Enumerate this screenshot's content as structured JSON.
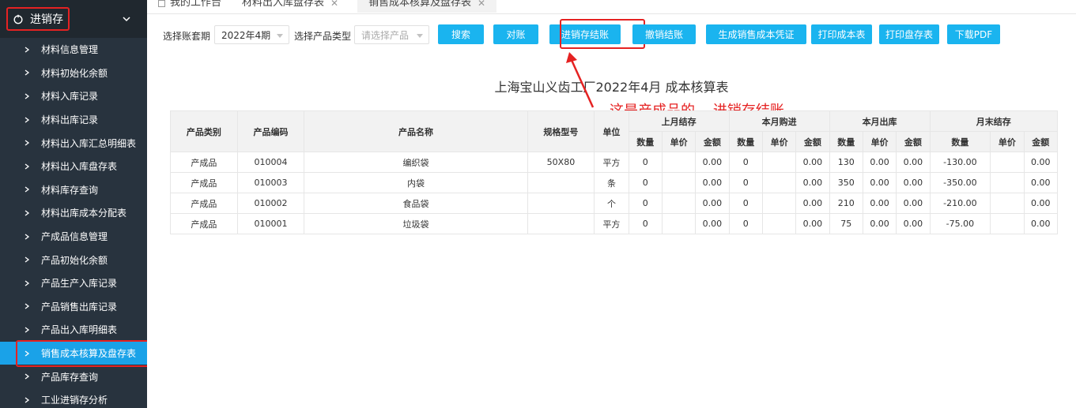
{
  "sidebar": {
    "title": "进销存",
    "items": [
      {
        "label": "材料信息管理"
      },
      {
        "label": "材料初始化余额"
      },
      {
        "label": "材料入库记录"
      },
      {
        "label": "材料出库记录"
      },
      {
        "label": "材料出入库汇总明细表"
      },
      {
        "label": "材料出入库盘存表"
      },
      {
        "label": "材料库存查询"
      },
      {
        "label": "材料出库成本分配表"
      },
      {
        "label": "产成品信息管理"
      },
      {
        "label": "产品初始化余额"
      },
      {
        "label": "产品生产入库记录"
      },
      {
        "label": "产品销售出库记录"
      },
      {
        "label": "产品出入库明细表"
      },
      {
        "label": "销售成本核算及盘存表",
        "active": true
      },
      {
        "label": "产品库存查询"
      },
      {
        "label": "工业进销存分析"
      }
    ]
  },
  "tabs": [
    {
      "label": "我的工作台"
    },
    {
      "label": "材料出入库盘存表"
    },
    {
      "label": "销售成本核算及盘存表",
      "active": true
    }
  ],
  "toolbar": {
    "period_label": "选择账套期",
    "period_value": "2022年4期",
    "type_label": "选择产品类型",
    "type_placeholder": "请选择产品",
    "buttons": {
      "search": "搜索",
      "reconcile": "对账",
      "close_account": "进销存结账",
      "undo_close": "撤销结账",
      "gen_voucher": "生成销售成本凭证",
      "print_cost": "打印成本表",
      "print_inventory": "打印盘存表",
      "download_pdf": "下载PDF"
    }
  },
  "report": {
    "title": "上海宝山义齿工厂2022年4月 成本核算表",
    "annotation": "这是产成品的    进销存结账"
  },
  "table": {
    "headers": {
      "category": "产品类别",
      "code": "产品编码",
      "name": "产品名称",
      "spec": "规格型号",
      "unit": "单位",
      "groups": [
        "上月结存",
        "本月购进",
        "本月出库",
        "月末结存"
      ],
      "sub": [
        "数量",
        "单价",
        "金额"
      ]
    },
    "rows": [
      [
        "产成品",
        "010004",
        "编织袋",
        "50X80",
        "平方",
        "0",
        "",
        "0.00",
        "0",
        "",
        "0.00",
        "130",
        "0.00",
        "0.00",
        "-130.00",
        "",
        "0.00"
      ],
      [
        "产成品",
        "010003",
        "内袋",
        "",
        "条",
        "0",
        "",
        "0.00",
        "0",
        "",
        "0.00",
        "350",
        "0.00",
        "0.00",
        "-350.00",
        "",
        "0.00"
      ],
      [
        "产成品",
        "010002",
        "食品袋",
        "",
        "个",
        "0",
        "",
        "0.00",
        "0",
        "",
        "0.00",
        "210",
        "0.00",
        "0.00",
        "-210.00",
        "",
        "0.00"
      ],
      [
        "产成品",
        "010001",
        "垃圾袋",
        "",
        "平方",
        "0",
        "",
        "0.00",
        "0",
        "",
        "0.00",
        "75",
        "0.00",
        "0.00",
        "-75.00",
        "",
        "0.00"
      ]
    ]
  },
  "colors": {
    "sidebar_bg": "#28333e",
    "active": "#1aa2e8",
    "button": "#1ab4ef",
    "highlight": "#e52222"
  }
}
